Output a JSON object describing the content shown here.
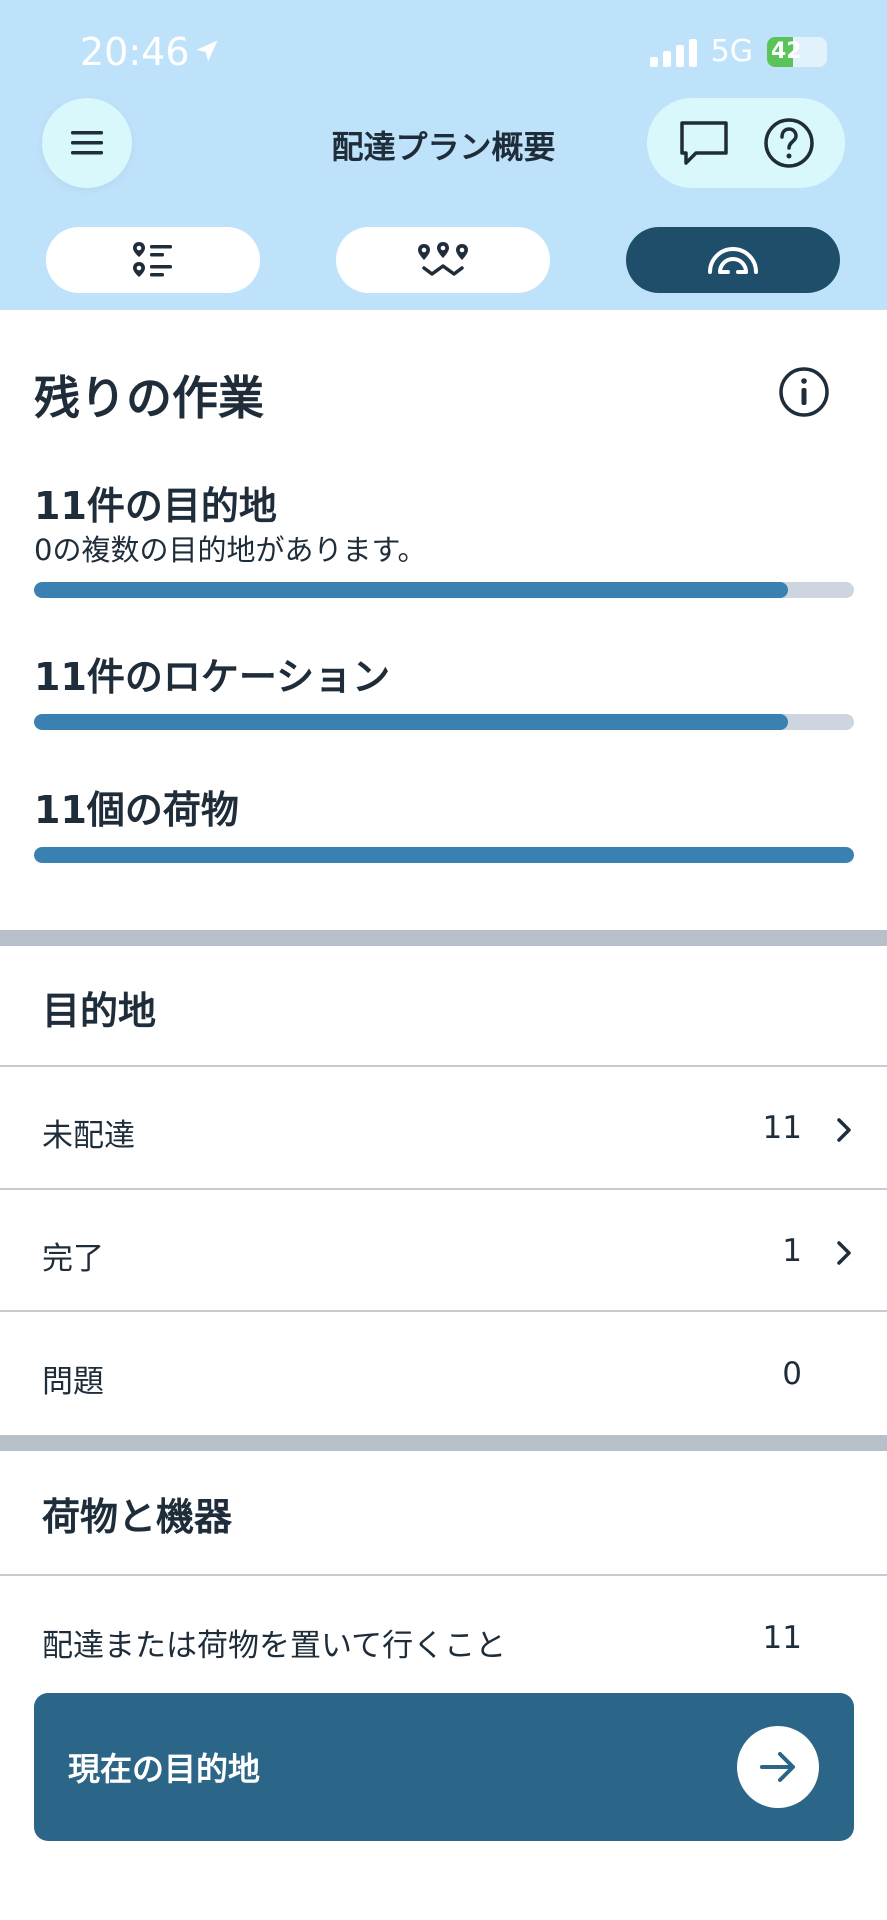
{
  "status_bar": {
    "time": "20:46",
    "network": "5G",
    "battery": "42"
  },
  "header": {
    "title": "配達プラン概要"
  },
  "icons": {
    "menu": "hamburger-menu-icon",
    "chat": "chat-bubble-icon",
    "help": "help-question-icon",
    "tab_list": "list-pins-icon",
    "tab_route": "route-pins-icon",
    "tab_gauge": "gauge-dial-icon",
    "info": "info-circle-icon",
    "arrow": "arrow-right-icon"
  },
  "remaining": {
    "heading": "残りの作業",
    "metrics": [
      {
        "title": "11件の目的地",
        "subtitle": "0の複数の目的地があります。",
        "progress": 0.92
      },
      {
        "title": "11件のロケーション",
        "progress": 0.92
      },
      {
        "title": "11個の荷物",
        "progress": 1.0
      }
    ]
  },
  "destinations": {
    "heading": "目的地",
    "rows": [
      {
        "label": "未配達",
        "value": "11",
        "chevron": true
      },
      {
        "label": "完了",
        "value": "1",
        "chevron": true
      },
      {
        "label": "問題",
        "value": "0",
        "chevron": false
      }
    ]
  },
  "packages": {
    "heading": "荷物と機器",
    "rows": [
      {
        "label": "配達または荷物を置いて行くこと",
        "value": "11"
      }
    ]
  },
  "cta": {
    "label": "現在の目的地"
  },
  "colors": {
    "header_bg": "#bfe2fb",
    "accent": "#3a80b1",
    "active_tab": "#1f4e6b",
    "cta_bg": "#2b6587"
  }
}
